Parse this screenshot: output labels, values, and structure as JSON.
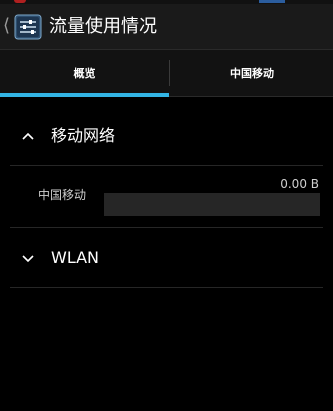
{
  "app": {
    "title": "流量使用情况"
  },
  "tabs": [
    {
      "label": "概览",
      "selected": true
    },
    {
      "label": "中国移动",
      "selected": false
    }
  ],
  "sections": {
    "mobile": {
      "label": "移动网络",
      "expanded": true,
      "items": [
        {
          "name": "中国移动",
          "usage": "0.00 B",
          "fraction": 0.0
        }
      ]
    },
    "wlan": {
      "label": "WLAN",
      "expanded": false
    }
  },
  "colors": {
    "accent": "#33b5e5",
    "background": "#000000",
    "action_bar": "#1a1a1a",
    "tab_bar": "#121212",
    "bar_track": "#262626"
  },
  "icons": {
    "back": "chevron-left-icon",
    "app": "data-usage-settings-icon",
    "expanded": "chevron-up-icon",
    "collapsed": "chevron-down-icon"
  }
}
